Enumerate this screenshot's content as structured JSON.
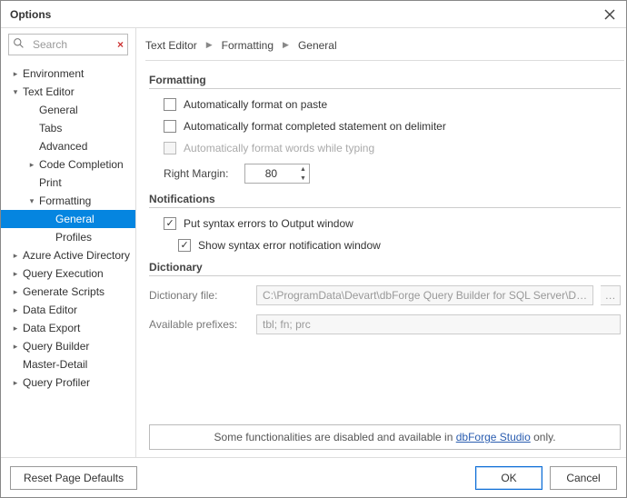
{
  "window": {
    "title": "Options"
  },
  "search": {
    "placeholder": "Search"
  },
  "tree": [
    {
      "level": 0,
      "twisty": "right",
      "label": "Environment"
    },
    {
      "level": 0,
      "twisty": "down",
      "label": "Text Editor"
    },
    {
      "level": 1,
      "twisty": "",
      "label": "General"
    },
    {
      "level": 1,
      "twisty": "",
      "label": "Tabs"
    },
    {
      "level": 1,
      "twisty": "",
      "label": "Advanced"
    },
    {
      "level": 1,
      "twisty": "right",
      "label": "Code Completion"
    },
    {
      "level": 1,
      "twisty": "",
      "label": "Print"
    },
    {
      "level": 1,
      "twisty": "down",
      "label": "Formatting"
    },
    {
      "level": 2,
      "twisty": "",
      "label": "General",
      "selected": true
    },
    {
      "level": 2,
      "twisty": "",
      "label": "Profiles"
    },
    {
      "level": 0,
      "twisty": "right",
      "label": "Azure Active Directory"
    },
    {
      "level": 0,
      "twisty": "right",
      "label": "Query Execution"
    },
    {
      "level": 0,
      "twisty": "right",
      "label": "Generate Scripts"
    },
    {
      "level": 0,
      "twisty": "right",
      "label": "Data Editor"
    },
    {
      "level": 0,
      "twisty": "right",
      "label": "Data Export"
    },
    {
      "level": 0,
      "twisty": "right",
      "label": "Query Builder"
    },
    {
      "level": 0,
      "twisty": "",
      "label": "Master-Detail"
    },
    {
      "level": 0,
      "twisty": "right",
      "label": "Query Profiler"
    }
  ],
  "breadcrumb": [
    "Text Editor",
    "Formatting",
    "General"
  ],
  "groups": {
    "formatting": {
      "title": "Formatting",
      "auto_paste": "Automatically format on paste",
      "auto_delimiter": "Automatically format completed statement on delimiter",
      "auto_typing": "Automatically format words while typing",
      "right_margin_label": "Right Margin:",
      "right_margin_value": "80"
    },
    "notifications": {
      "title": "Notifications",
      "syntax_output": "Put syntax errors to Output window",
      "syntax_popup": "Show syntax error notification window"
    },
    "dictionary": {
      "title": "Dictionary",
      "file_label": "Dictionary file:",
      "file_value": "C:\\ProgramData\\Devart\\dbForge Query Builder for SQL Server\\D…",
      "prefix_label": "Available prefixes:",
      "prefix_value": "tbl; fn; prc"
    }
  },
  "checks": {
    "auto_paste": false,
    "auto_delimiter": false,
    "auto_typing": false,
    "syntax_output": true,
    "syntax_popup": true
  },
  "banner": {
    "prefix": "Some functionalities are disabled and available in ",
    "link": "dbForge Studio",
    "suffix": " only."
  },
  "buttons": {
    "reset": "Reset Page Defaults",
    "ok": "OK",
    "cancel": "Cancel"
  }
}
